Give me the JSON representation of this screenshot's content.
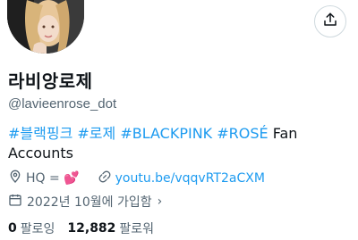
{
  "profile": {
    "display_name": "라비앙로제",
    "handle": "@lavieenrose_dot",
    "bio_hashtags": [
      "#블랙핑크",
      "#로제",
      "#BLACKPINK",
      "#ROSÉ"
    ],
    "bio_text": "Fan Accounts",
    "location": "HQ = 💕",
    "website": "youtu.be/vqqvRT2aCXM",
    "joined": "2022년 10월에 가입함",
    "following_count": "0",
    "following_label": "팔로잉",
    "followers_count": "12,882",
    "followers_label": "팔로워"
  },
  "icons": {
    "share": "share-icon",
    "location": "location-pin-icon",
    "link": "link-icon",
    "calendar": "calendar-icon",
    "chevron": "chevron-right-icon"
  },
  "colors": {
    "accent": "#1d9bf0",
    "secondary_text": "#536471",
    "primary_text": "#0f1419"
  }
}
